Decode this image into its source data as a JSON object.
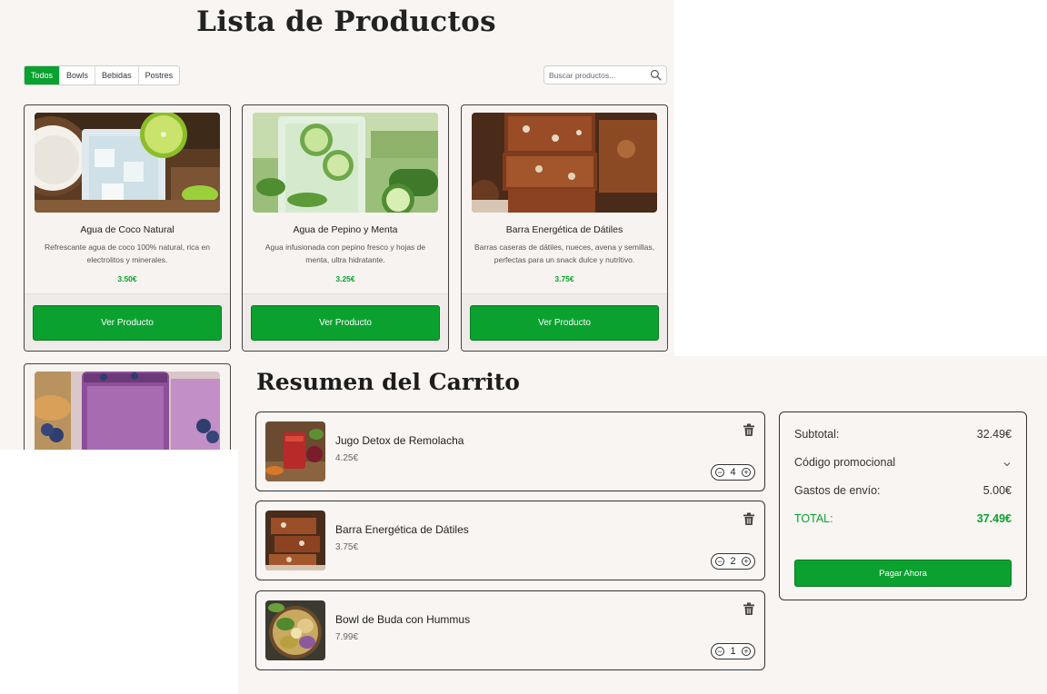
{
  "catalog": {
    "title": "Lista de Productos",
    "tabs": [
      {
        "label": "Todos",
        "active": true
      },
      {
        "label": "Bowls",
        "active": false
      },
      {
        "label": "Bebidas",
        "active": false
      },
      {
        "label": "Postres",
        "active": false
      }
    ],
    "search": {
      "placeholder": "Buscar productos...",
      "icon": "search-icon"
    },
    "products": [
      {
        "name": "Agua de Coco Natural",
        "description": "Refrescante agua de coco 100% natural, rica en electrolitos y minerales.",
        "price": "3.50€",
        "button": "Ver Producto"
      },
      {
        "name": "Agua de Pepino y Menta",
        "description": "Agua infusionada con pepino fresco y hojas de menta, ultra hidratante.",
        "price": "3.25€",
        "button": "Ver Producto"
      },
      {
        "name": "Barra Energética de Dátiles",
        "description": "Barras caseras de dátiles, nueces, avena y semillas, perfectas para un snack dulce y nutritivo.",
        "price": "3.75€",
        "button": "Ver Producto"
      }
    ]
  },
  "cart": {
    "title": "Resumen del Carrito",
    "items": [
      {
        "name": "Jugo Detox de Remolacha",
        "price": "4.25€",
        "quantity": "4",
        "minus": "−",
        "plus": "+"
      },
      {
        "name": "Barra Energética de Dátiles",
        "price": "3.75€",
        "quantity": "2",
        "minus": "−",
        "plus": "+"
      },
      {
        "name": "Bowl de Buda con Hummus",
        "price": "7.99€",
        "quantity": "1",
        "minus": "−",
        "plus": "+"
      }
    ],
    "summary": {
      "subtotal_label": "Subtotal:",
      "subtotal_value": "32.49€",
      "promo_label": "Código promocional",
      "shipping_label": "Gastos de envío:",
      "shipping_value": "5.00€",
      "total_label": "TOTAL:",
      "total_value": "37.49€",
      "pay_button": "Pagar Ahora"
    }
  },
  "colors": {
    "accent": "#0aa12f",
    "background": "#f8f5f2",
    "border": "#333333"
  }
}
